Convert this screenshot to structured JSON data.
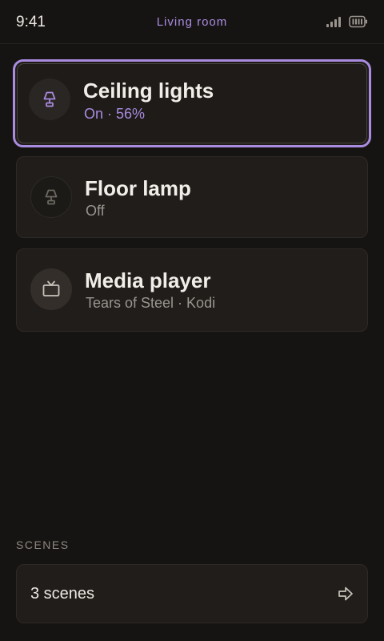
{
  "status": {
    "time": "9:41",
    "room": "Living room"
  },
  "devices": [
    {
      "name": "Ceiling lights",
      "status": "On · 56%",
      "icon": "lamp-icon",
      "selected": true
    },
    {
      "name": "Floor lamp",
      "status": "Off",
      "icon": "lamp-icon",
      "selected": false
    },
    {
      "name": "Media player",
      "status": "Tears of Steel · Kodi",
      "icon": "tv-icon",
      "selected": false
    }
  ],
  "scenes": {
    "label": "SCENES",
    "summary": "3 scenes"
  },
  "colors": {
    "accent": "#a98be0",
    "background": "#161412",
    "card": "#201d1a"
  }
}
